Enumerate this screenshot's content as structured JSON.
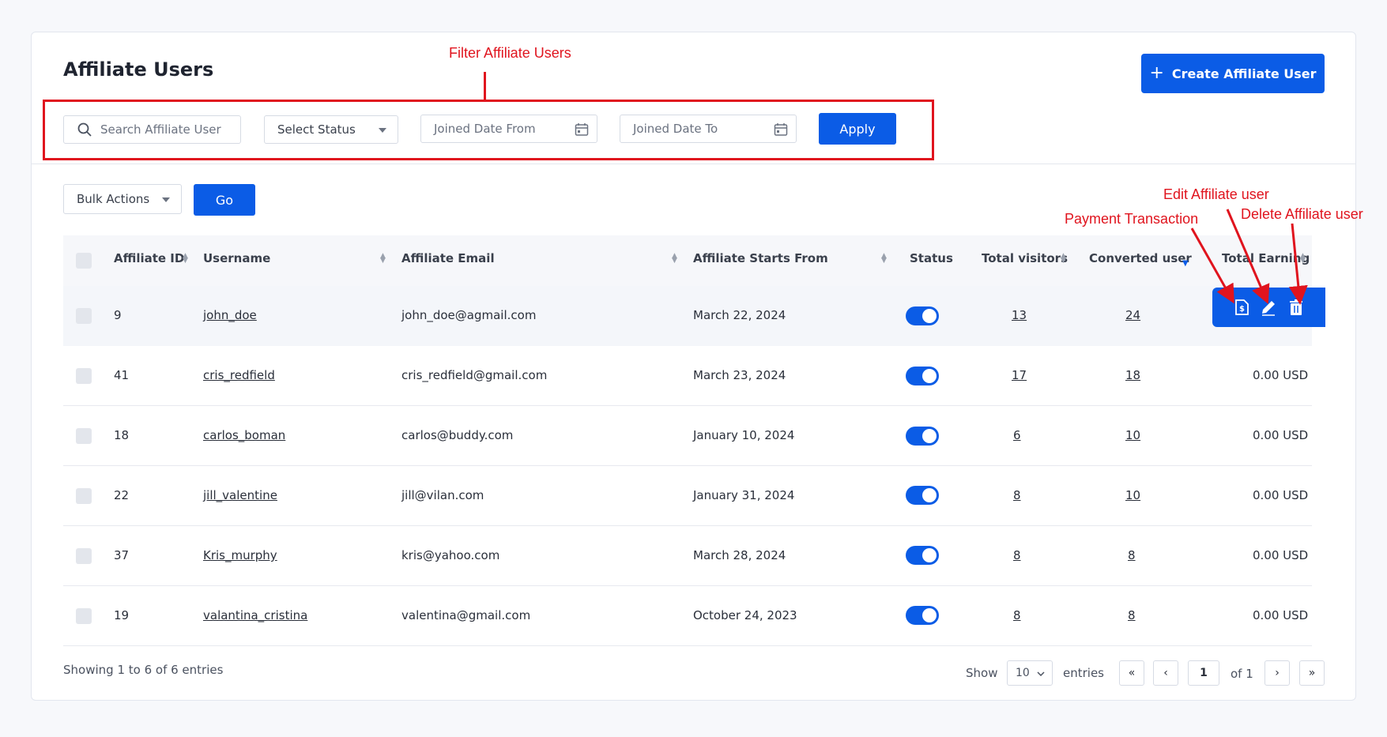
{
  "page": {
    "title": "Affiliate Users",
    "create_button": "Create Affiliate User"
  },
  "annotations": {
    "filter": "Filter Affiliate Users",
    "payment": "Payment Transaction",
    "edit": "Edit Affiliate user",
    "delete": "Delete Affiliate user"
  },
  "filters": {
    "search_placeholder": "Search Affiliate User",
    "status_placeholder": "Select Status",
    "date_from_placeholder": "Joined Date From",
    "date_to_placeholder": "Joined Date To",
    "apply_label": "Apply"
  },
  "bulk": {
    "select_label": "Bulk Actions",
    "go_label": "Go"
  },
  "table": {
    "columns": [
      "Affiliate ID",
      "Username",
      "Affiliate Email",
      "Affiliate Starts From",
      "Status",
      "Total visitors",
      "Converted user",
      "Total Earning"
    ],
    "rows": [
      {
        "id": "9",
        "username": "john_doe",
        "email": "john_doe@agmail.com",
        "start": "March 22, 2024",
        "status": true,
        "visitors": "13",
        "converted": "24",
        "earning": ""
      },
      {
        "id": "41",
        "username": "cris_redfield",
        "email": "cris_redfield@gmail.com",
        "start": "March 23, 2024",
        "status": true,
        "visitors": "17",
        "converted": "18",
        "earning": "0.00 USD"
      },
      {
        "id": "18",
        "username": "carlos_boman",
        "email": "carlos@buddy.com",
        "start": "January 10, 2024",
        "status": true,
        "visitors": "6",
        "converted": "10",
        "earning": "0.00 USD"
      },
      {
        "id": "22",
        "username": "jill_valentine",
        "email": "jill@vilan.com",
        "start": "January 31, 2024",
        "status": true,
        "visitors": "8",
        "converted": "10",
        "earning": "0.00 USD"
      },
      {
        "id": "37",
        "username": "Kris_murphy",
        "email": "kris@yahoo.com",
        "start": "March 28, 2024",
        "status": true,
        "visitors": "8",
        "converted": "8",
        "earning": "0.00 USD"
      },
      {
        "id": "19",
        "username": "valantina_cristina",
        "email": "valentina@gmail.com",
        "start": "October 24, 2023",
        "status": true,
        "visitors": "8",
        "converted": "8",
        "earning": "0.00 USD"
      }
    ]
  },
  "footer": {
    "showing": "Showing 1 to 6 of 6 entries",
    "show_label": "Show",
    "page_size": "10",
    "entries_label": "entries",
    "first": "«",
    "prev": "‹",
    "current_page": "1",
    "of_label": "of 1",
    "next": "›",
    "last": "»"
  },
  "colors": {
    "primary": "#0b5ce6",
    "annotation": "#e0141e"
  }
}
